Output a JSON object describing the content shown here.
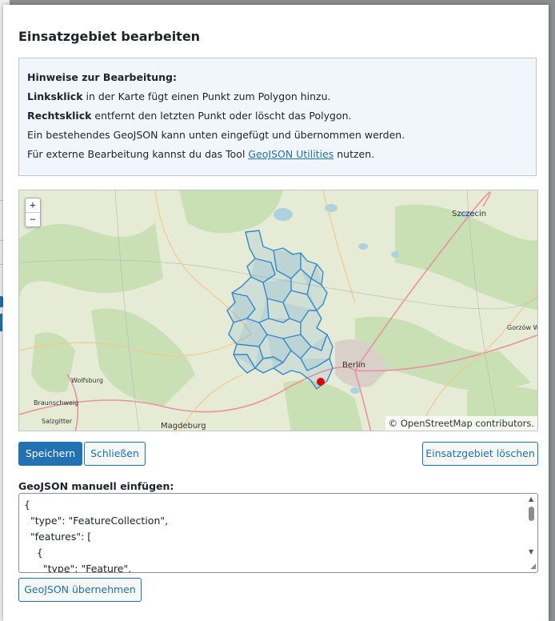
{
  "dialog": {
    "title": "Einsatzgebiet bearbeiten"
  },
  "notice": {
    "heading": "Hinweise zur Bearbeitung:",
    "line1_bold": "Linksklick",
    "line1_rest": " in der Karte fügt einen Punkt zum Polygon hinzu.",
    "line2_bold": "Rechtsklick",
    "line2_rest": " entfernt den letzten Punkt oder löscht das Polygon.",
    "line3": "Ein bestehendes GeoJSON kann unten eingefügt und übernommen werden.",
    "line4_pre": "Für externe Bearbeitung kannst du das Tool ",
    "line4_link": "GeoJSON Utilities",
    "line4_post": " nutzen."
  },
  "map": {
    "zoom_in": "+",
    "zoom_out": "−",
    "attribution": "© OpenStreetMap contributors.",
    "polygon_color": "#3388cc",
    "marker_color": "#e00000",
    "places": [
      {
        "name": "Szczecin"
      },
      {
        "name": "Berlin"
      },
      {
        "name": "Magdeburg"
      },
      {
        "name": "Wolfsburg"
      },
      {
        "name": "Braunschweig"
      },
      {
        "name": "Salzgitter"
      },
      {
        "name": "Gorzów Wlk"
      }
    ]
  },
  "actions": {
    "save": "Speichern",
    "close": "Schließen",
    "delete_area": "Einsatzgebiet löschen"
  },
  "geojson": {
    "label": "GeoJSON manuell einfügen:",
    "value": "{\n  \"type\": \"FeatureCollection\",\n  \"features\": [\n    {\n      \"type\": \"Feature\",",
    "apply": "GeoJSON übernehmen"
  }
}
